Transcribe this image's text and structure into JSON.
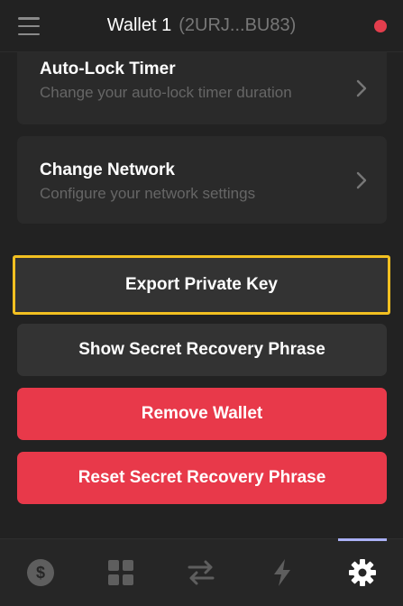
{
  "header": {
    "wallet_name": "Wallet 1",
    "wallet_address": "(2URJ...BU83)",
    "status_color": "#e33e4d"
  },
  "settings": {
    "auto_lock": {
      "title": "Auto-Lock Timer",
      "subtitle": "Change your auto-lock timer duration"
    },
    "change_network": {
      "title": "Change Network",
      "subtitle": "Configure your network settings"
    }
  },
  "actions": {
    "export_private_key": "Export Private Key",
    "show_secret_recovery_phrase": "Show Secret Recovery Phrase",
    "remove_wallet": "Remove Wallet",
    "reset_secret_recovery_phrase": "Reset Secret Recovery Phrase"
  },
  "colors": {
    "danger": "#e8394a",
    "highlight": "#f2c021",
    "active_tab": "#aab0f5"
  },
  "tabbar": {
    "tabs": [
      {
        "icon": "dollar-icon",
        "active": false
      },
      {
        "icon": "grid-icon",
        "active": false
      },
      {
        "icon": "swap-icon",
        "active": false
      },
      {
        "icon": "lightning-icon",
        "active": false
      },
      {
        "icon": "gear-icon",
        "active": true
      }
    ]
  }
}
